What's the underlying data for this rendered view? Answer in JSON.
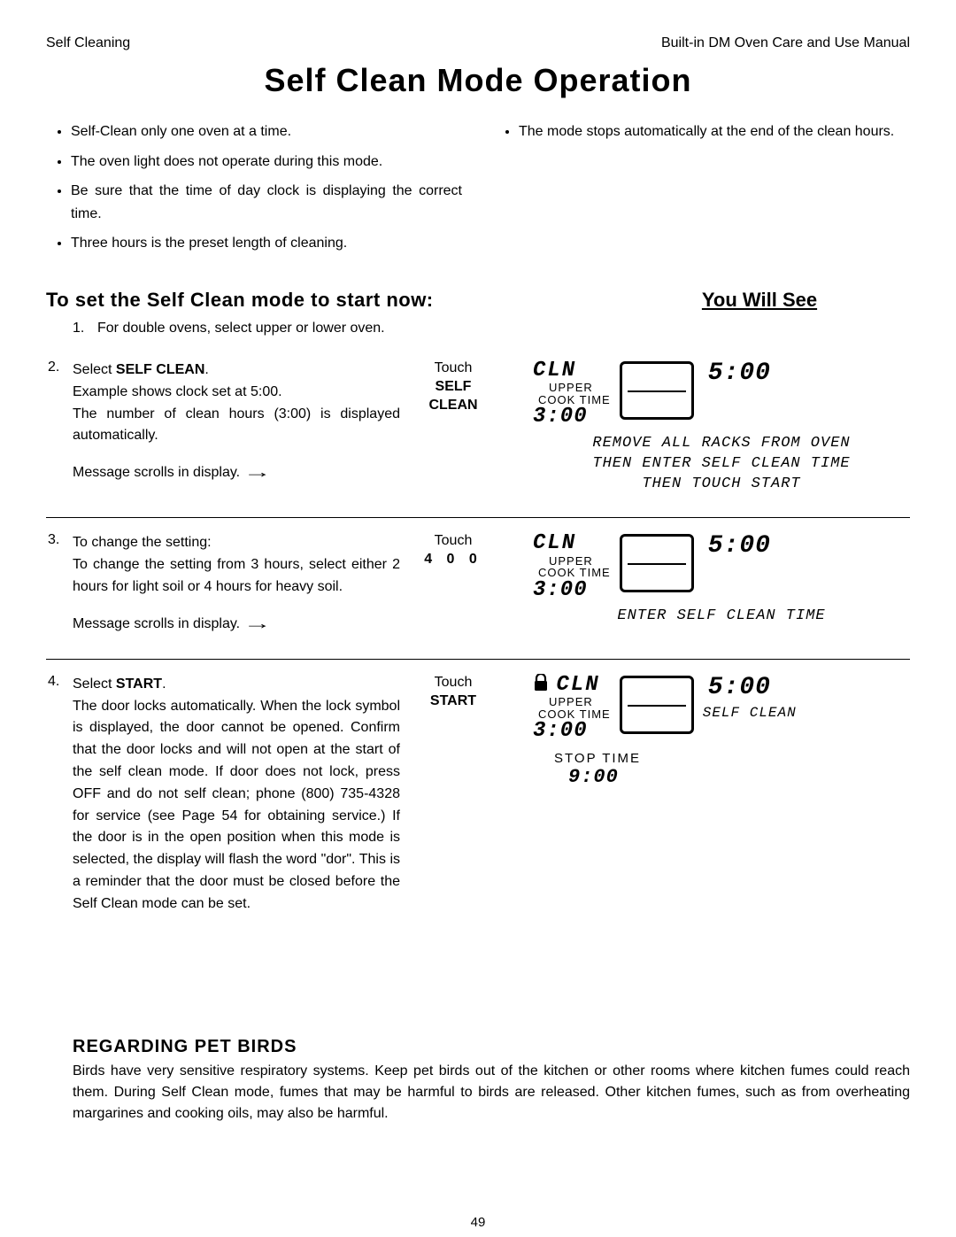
{
  "header": {
    "left": "Self Cleaning",
    "right": "Built-in DM Oven Care and Use Manual"
  },
  "title": "Self  Clean  Mode  Operation",
  "bullets_left": [
    "Self-Clean only one oven at a time.",
    "The oven light does not operate during this mode.",
    "Be sure that the time of day clock is displaying the correct time.",
    "Three hours is the preset length of cleaning."
  ],
  "bullets_right": [
    "The mode stops automatically at the end of the clean hours."
  ],
  "section_heading": "To set the Self Clean mode to start now:",
  "you_will_see": "You Will See",
  "step1": {
    "num": "1.",
    "text": "For double ovens, select upper or lower oven."
  },
  "step2": {
    "num": "2.",
    "lead": "Select ",
    "lead_bold": "SELF CLEAN",
    "lead_after": ".",
    "line2": "Example shows clock set at 5:00.",
    "line3": "The number of clean hours (3:00) is displayed automatically.",
    "scroll": "Message scrolls in display.",
    "touch": "Touch",
    "touch_btn1": "SELF",
    "touch_btn2": "CLEAN",
    "disp": {
      "cln": "CLN",
      "upper": "UPPER",
      "cooktime": "COOK TIME",
      "val": "3:00",
      "clock": "5:00",
      "msg1": "REMOVE ALL RACKS FROM OVEN",
      "msg2": "THEN ENTER SELF CLEAN TIME",
      "msg3": "THEN TOUCH START"
    }
  },
  "step3": {
    "num": "3.",
    "lead": "To change the setting:",
    "line2": "To change the setting from 3 hours, select either 2 hours for light soil or 4 hours for heavy soil.",
    "scroll": "Message scrolls in display.",
    "touch": "Touch",
    "touch_btn": "4 0 0",
    "disp": {
      "cln": "CLN",
      "upper": "UPPER",
      "cooktime": "COOK TIME",
      "val": "3:00",
      "clock": "5:00",
      "msg1": "ENTER SELF CLEAN TIME"
    }
  },
  "step4": {
    "num": "4.",
    "lead": "Select  ",
    "lead_bold": "START",
    "lead_after": ".",
    "body": "The door locks automatically. When the lock symbol is displayed, the door cannot be opened. Confirm that the door locks and will not open at the start of the self clean mode. If door does not lock, press OFF and do not self clean; phone (800) 735-4328 for service (see Page 54 for obtaining service.) If the door is in the open position when this  mode is selected, the display will flash the word \"dor\". This is a reminder that the door must be closed before the Self Clean mode can be set.",
    "touch": "Touch",
    "touch_btn": "START",
    "disp": {
      "cln": "CLN",
      "upper": "UPPER",
      "cooktime": "COOK TIME",
      "val": "3:00",
      "clock": "5:00",
      "selfclean": "SELF CLEAN",
      "stoptime_label": "STOP  TIME",
      "stoptime_val": "9:00"
    }
  },
  "birds": {
    "heading": "REGARDING PET BIRDS",
    "body": "Birds have very sensitive respiratory systems. Keep pet birds out of the kitchen or other rooms where kitchen fumes could reach them. During Self Clean mode, fumes that may be harmful to birds are released. Other kitchen fumes, such as from overheating margarines and cooking oils, may also be harmful."
  },
  "page_num": "49"
}
